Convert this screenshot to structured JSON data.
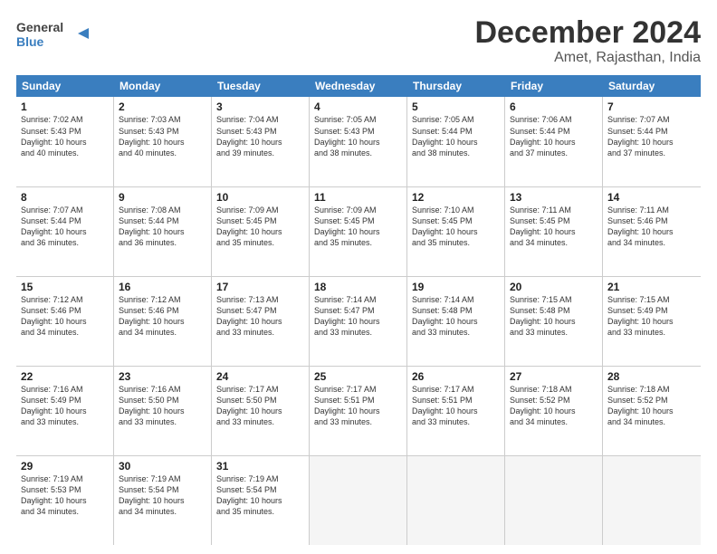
{
  "header": {
    "logo_general": "General",
    "logo_blue": "Blue",
    "title": "December 2024",
    "subtitle": "Amet, Rajasthan, India"
  },
  "calendar": {
    "days_of_week": [
      "Sunday",
      "Monday",
      "Tuesday",
      "Wednesday",
      "Thursday",
      "Friday",
      "Saturday"
    ],
    "weeks": [
      [
        {
          "day": "",
          "empty": true
        },
        {
          "day": "",
          "empty": true
        },
        {
          "day": "",
          "empty": true
        },
        {
          "day": "",
          "empty": true
        },
        {
          "day": "",
          "empty": true
        },
        {
          "day": "",
          "empty": true
        },
        {
          "day": "",
          "empty": true
        }
      ],
      [
        {
          "day": "1",
          "lines": [
            "Sunrise: 7:02 AM",
            "Sunset: 5:43 PM",
            "Daylight: 10 hours",
            "and 40 minutes."
          ]
        },
        {
          "day": "2",
          "lines": [
            "Sunrise: 7:03 AM",
            "Sunset: 5:43 PM",
            "Daylight: 10 hours",
            "and 40 minutes."
          ]
        },
        {
          "day": "3",
          "lines": [
            "Sunrise: 7:04 AM",
            "Sunset: 5:43 PM",
            "Daylight: 10 hours",
            "and 39 minutes."
          ]
        },
        {
          "day": "4",
          "lines": [
            "Sunrise: 7:05 AM",
            "Sunset: 5:43 PM",
            "Daylight: 10 hours",
            "and 38 minutes."
          ]
        },
        {
          "day": "5",
          "lines": [
            "Sunrise: 7:05 AM",
            "Sunset: 5:44 PM",
            "Daylight: 10 hours",
            "and 38 minutes."
          ]
        },
        {
          "day": "6",
          "lines": [
            "Sunrise: 7:06 AM",
            "Sunset: 5:44 PM",
            "Daylight: 10 hours",
            "and 37 minutes."
          ]
        },
        {
          "day": "7",
          "lines": [
            "Sunrise: 7:07 AM",
            "Sunset: 5:44 PM",
            "Daylight: 10 hours",
            "and 37 minutes."
          ]
        }
      ],
      [
        {
          "day": "8",
          "lines": [
            "Sunrise: 7:07 AM",
            "Sunset: 5:44 PM",
            "Daylight: 10 hours",
            "and 36 minutes."
          ]
        },
        {
          "day": "9",
          "lines": [
            "Sunrise: 7:08 AM",
            "Sunset: 5:44 PM",
            "Daylight: 10 hours",
            "and 36 minutes."
          ]
        },
        {
          "day": "10",
          "lines": [
            "Sunrise: 7:09 AM",
            "Sunset: 5:45 PM",
            "Daylight: 10 hours",
            "and 35 minutes."
          ]
        },
        {
          "day": "11",
          "lines": [
            "Sunrise: 7:09 AM",
            "Sunset: 5:45 PM",
            "Daylight: 10 hours",
            "and 35 minutes."
          ]
        },
        {
          "day": "12",
          "lines": [
            "Sunrise: 7:10 AM",
            "Sunset: 5:45 PM",
            "Daylight: 10 hours",
            "and 35 minutes."
          ]
        },
        {
          "day": "13",
          "lines": [
            "Sunrise: 7:11 AM",
            "Sunset: 5:45 PM",
            "Daylight: 10 hours",
            "and 34 minutes."
          ]
        },
        {
          "day": "14",
          "lines": [
            "Sunrise: 7:11 AM",
            "Sunset: 5:46 PM",
            "Daylight: 10 hours",
            "and 34 minutes."
          ]
        }
      ],
      [
        {
          "day": "15",
          "lines": [
            "Sunrise: 7:12 AM",
            "Sunset: 5:46 PM",
            "Daylight: 10 hours",
            "and 34 minutes."
          ]
        },
        {
          "day": "16",
          "lines": [
            "Sunrise: 7:12 AM",
            "Sunset: 5:46 PM",
            "Daylight: 10 hours",
            "and 34 minutes."
          ]
        },
        {
          "day": "17",
          "lines": [
            "Sunrise: 7:13 AM",
            "Sunset: 5:47 PM",
            "Daylight: 10 hours",
            "and 33 minutes."
          ]
        },
        {
          "day": "18",
          "lines": [
            "Sunrise: 7:14 AM",
            "Sunset: 5:47 PM",
            "Daylight: 10 hours",
            "and 33 minutes."
          ]
        },
        {
          "day": "19",
          "lines": [
            "Sunrise: 7:14 AM",
            "Sunset: 5:48 PM",
            "Daylight: 10 hours",
            "and 33 minutes."
          ]
        },
        {
          "day": "20",
          "lines": [
            "Sunrise: 7:15 AM",
            "Sunset: 5:48 PM",
            "Daylight: 10 hours",
            "and 33 minutes."
          ]
        },
        {
          "day": "21",
          "lines": [
            "Sunrise: 7:15 AM",
            "Sunset: 5:49 PM",
            "Daylight: 10 hours",
            "and 33 minutes."
          ]
        }
      ],
      [
        {
          "day": "22",
          "lines": [
            "Sunrise: 7:16 AM",
            "Sunset: 5:49 PM",
            "Daylight: 10 hours",
            "and 33 minutes."
          ]
        },
        {
          "day": "23",
          "lines": [
            "Sunrise: 7:16 AM",
            "Sunset: 5:50 PM",
            "Daylight: 10 hours",
            "and 33 minutes."
          ]
        },
        {
          "day": "24",
          "lines": [
            "Sunrise: 7:17 AM",
            "Sunset: 5:50 PM",
            "Daylight: 10 hours",
            "and 33 minutes."
          ]
        },
        {
          "day": "25",
          "lines": [
            "Sunrise: 7:17 AM",
            "Sunset: 5:51 PM",
            "Daylight: 10 hours",
            "and 33 minutes."
          ]
        },
        {
          "day": "26",
          "lines": [
            "Sunrise: 7:17 AM",
            "Sunset: 5:51 PM",
            "Daylight: 10 hours",
            "and 33 minutes."
          ]
        },
        {
          "day": "27",
          "lines": [
            "Sunrise: 7:18 AM",
            "Sunset: 5:52 PM",
            "Daylight: 10 hours",
            "and 34 minutes."
          ]
        },
        {
          "day": "28",
          "lines": [
            "Sunrise: 7:18 AM",
            "Sunset: 5:52 PM",
            "Daylight: 10 hours",
            "and 34 minutes."
          ]
        }
      ],
      [
        {
          "day": "29",
          "lines": [
            "Sunrise: 7:19 AM",
            "Sunset: 5:53 PM",
            "Daylight: 10 hours",
            "and 34 minutes."
          ]
        },
        {
          "day": "30",
          "lines": [
            "Sunrise: 7:19 AM",
            "Sunset: 5:54 PM",
            "Daylight: 10 hours",
            "and 34 minutes."
          ]
        },
        {
          "day": "31",
          "lines": [
            "Sunrise: 7:19 AM",
            "Sunset: 5:54 PM",
            "Daylight: 10 hours",
            "and 35 minutes."
          ]
        },
        {
          "day": "",
          "empty": true
        },
        {
          "day": "",
          "empty": true
        },
        {
          "day": "",
          "empty": true
        },
        {
          "day": "",
          "empty": true
        }
      ]
    ]
  }
}
